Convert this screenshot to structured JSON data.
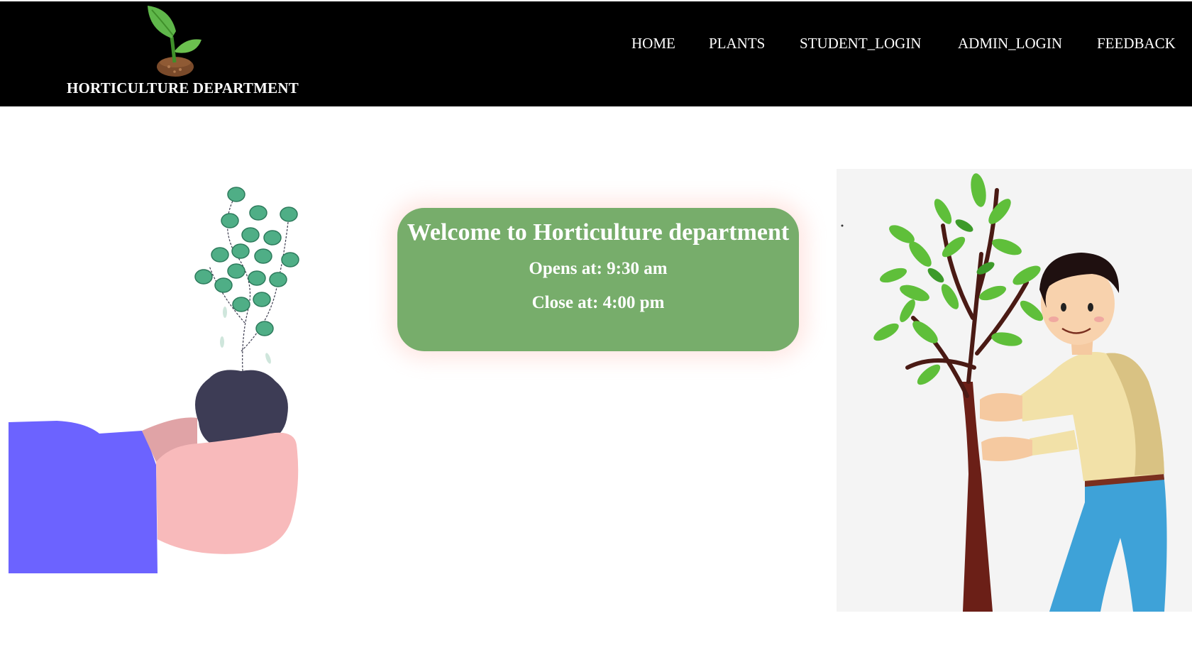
{
  "brand": {
    "name": "HORTICULTURE DEPARTMENT",
    "logo_icon": "sprout-icon"
  },
  "nav": {
    "home": "HOME",
    "plants": "PLANTS",
    "student_login": "STUDENT_LOGIN",
    "admin_login": "ADMIN_LOGIN",
    "feedback": "FEEDBACK"
  },
  "welcome": {
    "title": "Welcome to Horticulture department",
    "opens": "Opens at: 9:30 am",
    "close": "Close at: 4:00 pm"
  },
  "illustrations": {
    "left": "hands-holding-plant-illustration",
    "right": "boy-planting-tree-illustration"
  },
  "colors": {
    "navbar": "#000000",
    "card": "#77ad6b",
    "leaf": "#5fb74a"
  }
}
